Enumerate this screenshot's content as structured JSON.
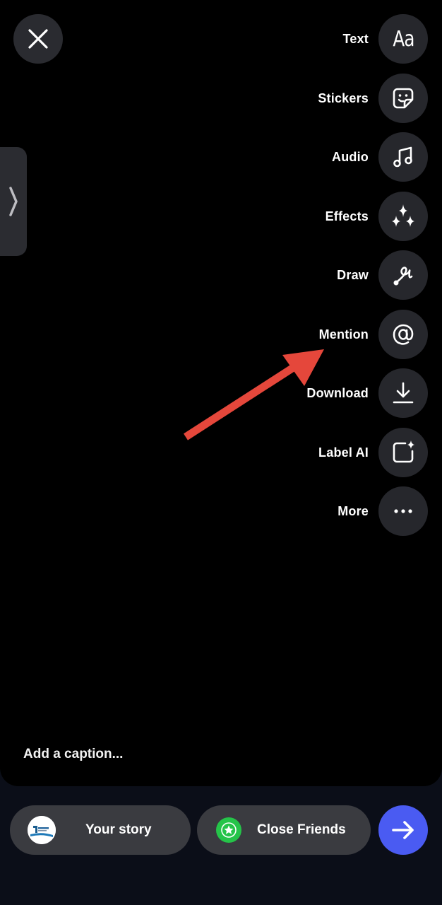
{
  "editor": {
    "caption_placeholder": "Add a caption...",
    "close_icon": "close-icon",
    "side_tab_icon": "chevron-right-icon"
  },
  "tools": [
    {
      "label": "Text",
      "icon": "text-aa-icon",
      "glyph": "Aa"
    },
    {
      "label": "Stickers",
      "icon": "sticker-icon"
    },
    {
      "label": "Audio",
      "icon": "music-note-icon"
    },
    {
      "label": "Effects",
      "icon": "sparkles-icon"
    },
    {
      "label": "Draw",
      "icon": "squiggle-icon"
    },
    {
      "label": "Mention",
      "icon": "at-sign-icon"
    },
    {
      "label": "Download",
      "icon": "download-icon"
    },
    {
      "label": "Label AI",
      "icon": "ai-label-icon"
    },
    {
      "label": "More",
      "icon": "more-dots-icon",
      "glyph": "•••"
    }
  ],
  "share": {
    "your_story_label": "Your story",
    "close_friends_label": "Close Friends",
    "send_icon": "arrow-right-icon"
  },
  "colors": {
    "annotation_arrow": "#e5473b",
    "send_button": "#4a5bf2",
    "close_friends_badge": "#25c449"
  }
}
